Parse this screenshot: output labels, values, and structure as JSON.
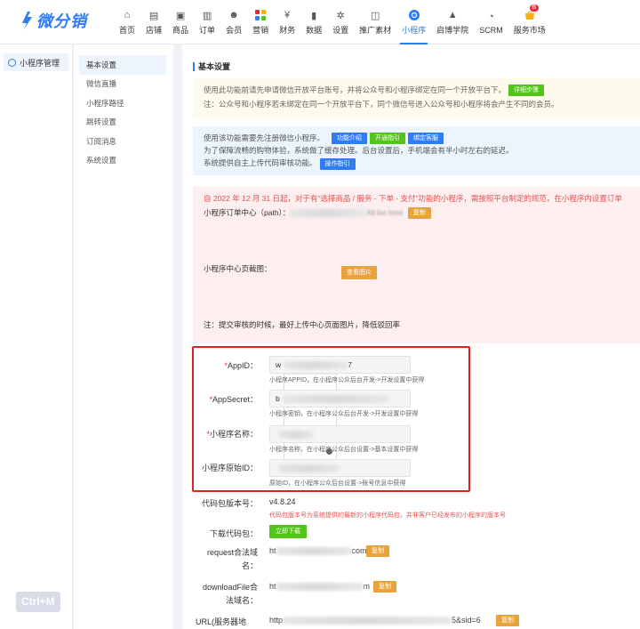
{
  "brand": {
    "name": "微分销",
    "color": "#2f7cf6"
  },
  "nav": [
    {
      "label": "首页",
      "icon": "home-icon"
    },
    {
      "label": "店铺",
      "icon": "store-icon"
    },
    {
      "label": "商品",
      "icon": "box-icon"
    },
    {
      "label": "订单",
      "icon": "order-icon"
    },
    {
      "label": "会员",
      "icon": "users-icon"
    },
    {
      "label": "营销",
      "icon": "marketing-icon"
    },
    {
      "label": "财务",
      "icon": "finance-icon"
    },
    {
      "label": "数据",
      "icon": "chart-icon"
    },
    {
      "label": "设置",
      "icon": "gear-icon"
    },
    {
      "label": "推广素材",
      "icon": "material-icon"
    },
    {
      "label": "小程序",
      "icon": "miniprogram-icon",
      "active": true
    },
    {
      "label": "启博学院",
      "icon": "academy-icon"
    },
    {
      "label": "SCRM",
      "icon": "pie-icon"
    },
    {
      "label": "服务市场",
      "icon": "market-icon",
      "badge": "新"
    }
  ],
  "sidebar_primary": {
    "label": "小程序管理",
    "icon": "gear-icon"
  },
  "sidebar_secondary": [
    "基本设置",
    "微信直播",
    "小程序路径",
    "跳转设置",
    "订阅消息",
    "系统设置"
  ],
  "section_title": "基本设置",
  "notice_yellow": {
    "line1": "使用此功能前请先申请微信开放平台账号，并将公众号和小程序绑定在同一个开放平台下。",
    "button": "详细步骤",
    "line2": "注：公众号和小程序若未绑定在同一个开放平台下，同个微信号进入公众号和小程序将会产生不同的会员。"
  },
  "notice_blue": {
    "line1": "使用该功能需要先注册微信小程序。",
    "buttons": [
      "功能介绍",
      "开通指引",
      "绑定客服"
    ],
    "line2": "为了保障流畅的购物体验，系统做了缓存处理。后台设置后，手机端会有半小时左右的延迟。",
    "line3": "系统提供自主上传代码审核功能。",
    "button3": "操作指引"
  },
  "notice_red": {
    "line1": "自 2022 年 12 月 31 日起，对于有“选择商品 / 服务 - 下单 - 支付”功能的小程序，需按照平台制定的规范，在小程序内设置订单",
    "path_label": "小程序订单中心（path）：",
    "path_value": "All.list.html",
    "copy_label": "复制",
    "screenshot_label": "小程序中心页截图：",
    "view_label": "查看图片",
    "note": "注：提交审核的时候，最好上传中心页面图片，降低驳回率"
  },
  "fields": [
    {
      "label": "AppID：",
      "required": true,
      "value_head": "w",
      "value_tail": "7",
      "hint": "小程序APPID，在小程序公众后台开发->开发设置中获得"
    },
    {
      "label": "AppSecret：",
      "required": true,
      "value_head": "b",
      "value_tail": "",
      "hint": "小程序密钥，在小程序公众后台开发->开发设置中获得"
    },
    {
      "label": "小程序名称：",
      "required": true,
      "value_head": "",
      "value_tail": "",
      "hint": "小程序名称，在小程序公众后台设置->基本设置中获得"
    },
    {
      "label": "小程序原始ID：",
      "required": false,
      "value_head": "",
      "value_tail": "",
      "hint": "原始ID，在小程序公众后台设置->账号信息中获得"
    }
  ],
  "version": {
    "label": "代码包版本号：",
    "value": "v4.8.24",
    "note": "代码包版本号为系统提供的最新的小程序代码包，并非客户已经发布的小程序的版本号"
  },
  "download": {
    "label": "下载代码包：",
    "button": "立即下载"
  },
  "domains": [
    {
      "label_a": "request合法域",
      "label_b": "名：",
      "head": "ht",
      "tail": "com",
      "button": "复制"
    },
    {
      "label_a": "downloadFile合",
      "label_b": "法域名：",
      "head": "ht",
      "tail": "m",
      "button": "复制"
    },
    {
      "label_a": "URL(服务器地",
      "label_b": "",
      "head": "http",
      "tail": "5&sid=6",
      "button": "复制"
    }
  ],
  "shortcut": "Ctrl+M"
}
